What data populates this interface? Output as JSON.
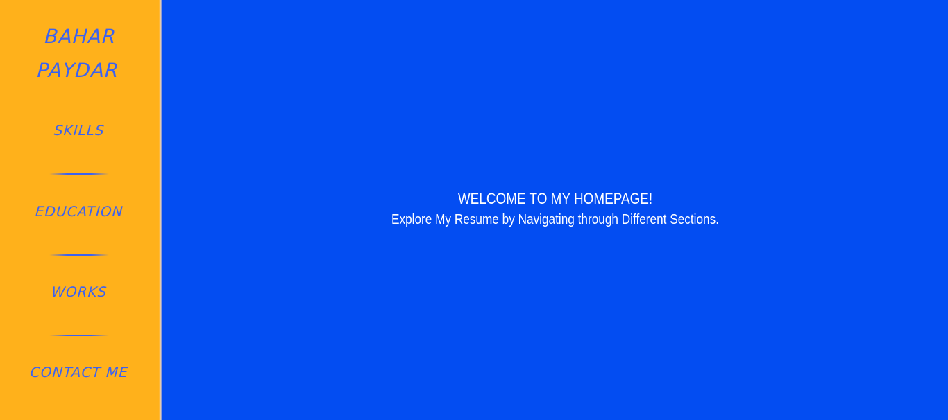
{
  "brand": {
    "first_name": "BAHAR",
    "last_name": "PAYDAR"
  },
  "nav": {
    "items": [
      {
        "label": "SKILLS"
      },
      {
        "label": "EDUCATION"
      },
      {
        "label": "WORKS"
      },
      {
        "label": "CONTACT ME"
      }
    ]
  },
  "main": {
    "title": "WELCOME TO MY HOMEPAGE!",
    "subtitle": "Explore My Resume by Navigating through Different Sections."
  },
  "colors": {
    "sidebar_bg": "#ffb11b",
    "main_bg": "#034df2",
    "nav_text": "#3c62f0",
    "main_text": "#ffffff"
  }
}
